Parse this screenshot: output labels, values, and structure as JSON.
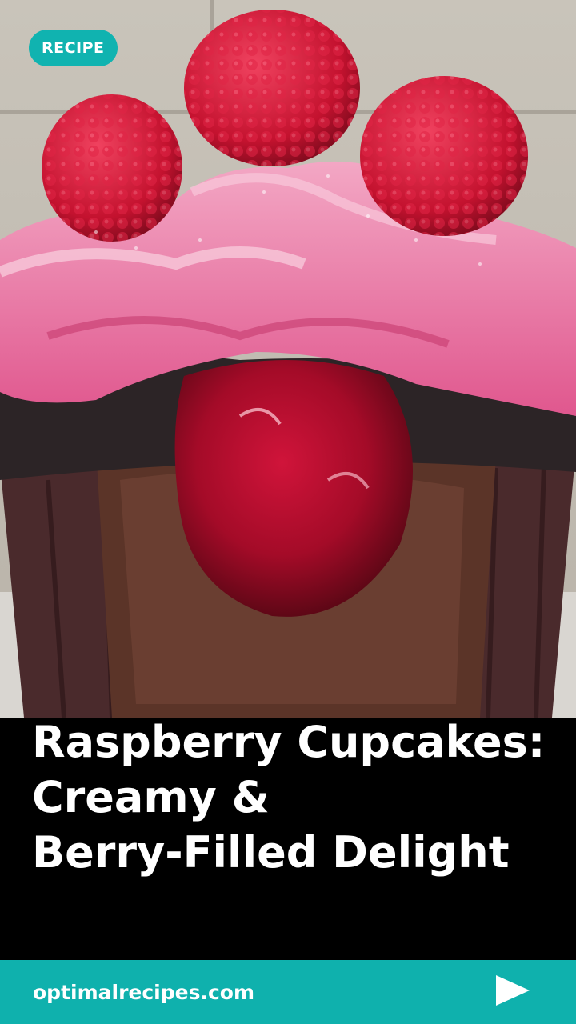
{
  "badge": {
    "label": "RECIPE"
  },
  "title": {
    "lines": [
      "Raspberry Cupcakes:",
      "Creamy &",
      "Berry-Filled Delight"
    ]
  },
  "footer": {
    "site": "optimalrecipes.com",
    "action_icon": "play-arrow-icon"
  },
  "colors": {
    "accent": "#0fb1ad",
    "title_bg": "#000000",
    "text": "#ffffff"
  },
  "photo": {
    "subject": "raspberry cupcake photo"
  }
}
